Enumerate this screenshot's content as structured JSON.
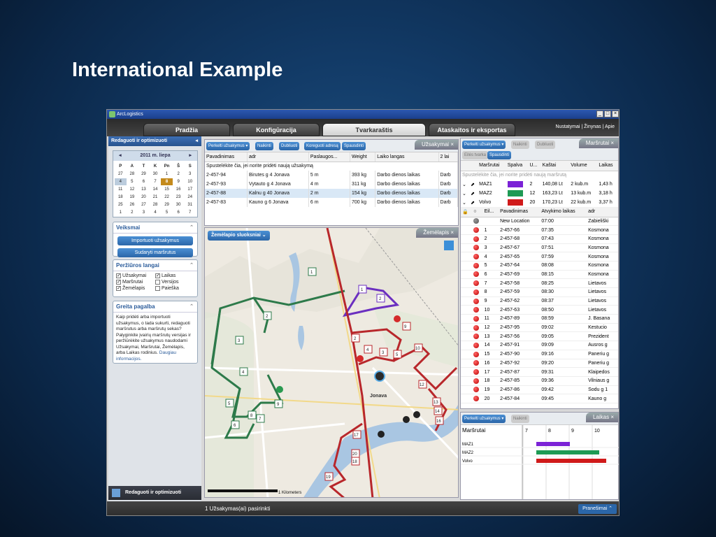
{
  "slide": {
    "title": "International Example"
  },
  "window": {
    "title": "ArcLogistics"
  },
  "ribbon": {
    "tabs": [
      "Pradžia",
      "Konfigūracija",
      "Tvarkaraštis",
      "Ataskaitos ir eksportas"
    ],
    "active_tab": "Tvarkaraštis",
    "links": "Nustatymai | Žinynas | Apie"
  },
  "left_panel": {
    "header": "Redaguoti ir optimizuoti",
    "calendar": {
      "month": "2011 m. liepa",
      "day_names": [
        "P",
        "A",
        "T",
        "K",
        "Pn",
        "Š",
        "S"
      ],
      "weeks": [
        [
          "27",
          "28",
          "29",
          "30",
          "1",
          "2",
          "3"
        ],
        [
          "4",
          "5",
          "6",
          "7",
          "8",
          "9",
          "10"
        ],
        [
          "11",
          "12",
          "13",
          "14",
          "15",
          "16",
          "17"
        ],
        [
          "18",
          "19",
          "20",
          "21",
          "22",
          "23",
          "24"
        ],
        [
          "25",
          "26",
          "27",
          "28",
          "29",
          "30",
          "31"
        ],
        [
          "1",
          "2",
          "3",
          "4",
          "5",
          "6",
          "7"
        ]
      ],
      "selected": "8"
    },
    "actions": {
      "title": "Veiksmai",
      "buttons": [
        "Importuoti užsakymus",
        "Sudaryti maršrutus"
      ]
    },
    "views": {
      "title": "Peržiūros langai",
      "items": [
        {
          "label": "Užsakymai",
          "checked": true
        },
        {
          "label": "Laikas",
          "checked": true
        },
        {
          "label": "Maršrutai",
          "checked": true
        },
        {
          "label": "Versijos",
          "checked": false
        },
        {
          "label": "Žemėlapis",
          "checked": true
        },
        {
          "label": "Paieška",
          "checked": false
        }
      ]
    },
    "help": {
      "title": "Greita pagalba",
      "text": "Kaip pridėti arba importuoti užsakymus, o tada sukurti, redaguoti maršrutus arba maršrutų sekas? Palyginkite įvairių maršrutų versijas ir peržiūrėkite užsakymus naudodami Užsakymai, Maršrutai, Žemėlapis, arba Laikas rodinius.",
      "link": "Daugiau informacijos."
    },
    "footer": "Redaguoti ir optimizuoti"
  },
  "orders": {
    "title": "Užsakymai",
    "toolbar": [
      "Perkelti užsakymus ▾",
      "Naikinti",
      "Dubliuoti",
      "Koreguoti adresą",
      "Spausdinti"
    ],
    "columns": [
      "Pavadinimas",
      "adr",
      "Paslaugos...",
      "Weight",
      "Laiko langas",
      "2 lai"
    ],
    "hint": "Spustelėkite čia, jei norite pridėti naują užsakymą",
    "rows": [
      [
        "2-457-94",
        "Birutes g 4 Jonava",
        "5 m",
        "393 kg",
        "Darbo dienos laikas",
        "Darb"
      ],
      [
        "2-457-93",
        "Vytauto g 4 Jonava",
        "4 m",
        "311 kg",
        "Darbo dienos laikas",
        "Darb"
      ],
      [
        "2-457-88",
        "Kalnu g 40 Jonava",
        "2 m",
        "154 kg",
        "Darbo dienos laikas",
        "Darb"
      ],
      [
        "2-457-83",
        "Kauno g 6 Jonava",
        "6 m",
        "700 kg",
        "Darbo dienos laikas",
        "Darb"
      ]
    ]
  },
  "map": {
    "title": "Žemėlapis",
    "layers_button": "Žemėlapio sluoksniai",
    "town": "Jonava",
    "scale": "1 Kilometers",
    "route_stops": {
      "green": [
        "1",
        "2",
        "3",
        "4",
        "5",
        "6",
        "7",
        "8",
        "9"
      ],
      "purple": [
        "1",
        "2"
      ],
      "red": [
        "2",
        "3",
        "4",
        "5",
        "9",
        "10",
        "11",
        "12",
        "13",
        "14",
        "15",
        "16",
        "17",
        "18",
        "19",
        "20"
      ]
    }
  },
  "routes": {
    "title": "Maršrutai",
    "toolbar": [
      "Perkelti užsakymus ▾",
      "Naikinti",
      "Dubliuoti",
      "Eilės tvarka",
      "Spausdinti"
    ],
    "columns": [
      "Maršrutai",
      "Spalva",
      "U...",
      "Kaštai",
      "Volume",
      "Laikas"
    ],
    "hint": "Spustelėkite čia, jei norite pridėti naują maršrutą",
    "rows": [
      {
        "name": "MAZ1",
        "color": "#7b22d6",
        "u": "2",
        "cost": "140,08 Lt",
        "volume": "2 kub.m",
        "time": "1,43 h"
      },
      {
        "name": "MAZ2",
        "color": "#1e9a54",
        "u": "12",
        "cost": "163,23 Lt",
        "volume": "13 kub.m",
        "time": "3,18 h"
      },
      {
        "name": "Volvo",
        "color": "#d01a1a",
        "u": "20",
        "cost": "170,23 Lt",
        "volume": "22 kub.m",
        "time": "3,37 h"
      }
    ],
    "stop_columns": [
      "Eil...",
      "Pavadinimas",
      "Atvykimo laikas",
      "adr"
    ],
    "stops": [
      [
        "",
        "New Location",
        "07:00",
        "Zabieliški"
      ],
      [
        "1",
        "2-457-66",
        "07:35",
        "Kosmona"
      ],
      [
        "2",
        "2-457-68",
        "07:43",
        "Kosmona"
      ],
      [
        "3",
        "2-457-67",
        "07:51",
        "Kosmona"
      ],
      [
        "4",
        "2-457-65",
        "07:59",
        "Kosmona"
      ],
      [
        "5",
        "2-457-64",
        "08:08",
        "Kosmona"
      ],
      [
        "6",
        "2-457-69",
        "08:15",
        "Kosmona"
      ],
      [
        "7",
        "2-457-58",
        "08:25",
        "Lietavos"
      ],
      [
        "8",
        "2-457-59",
        "08:30",
        "Lietavos"
      ],
      [
        "9",
        "2-457-62",
        "08:37",
        "Lietavos"
      ],
      [
        "10",
        "2-457-63",
        "08:50",
        "Lietavos"
      ],
      [
        "11",
        "2-457-89",
        "08:59",
        "J. Basana"
      ],
      [
        "12",
        "2-457-95",
        "09:02",
        "Kestucio"
      ],
      [
        "13",
        "2-457-56",
        "09:05",
        "Prezident"
      ],
      [
        "14",
        "2-457-91",
        "09:09",
        "Ausros g"
      ],
      [
        "15",
        "2-457-90",
        "09:16",
        "Paneriu g"
      ],
      [
        "16",
        "2-457-92",
        "09:20",
        "Paneriu g"
      ],
      [
        "17",
        "2-457-87",
        "09:31",
        "Klaipedos"
      ],
      [
        "18",
        "2-457-85",
        "09:36",
        "Vilniaus g"
      ],
      [
        "19",
        "2-457-86",
        "09:42",
        "Sodu g 1"
      ],
      [
        "20",
        "2-457-84",
        "09:45",
        "Kauno g"
      ]
    ]
  },
  "timeline": {
    "title": "Laikas",
    "toolbar": [
      "Perkelti užsakymus ▾",
      "Naikinti"
    ],
    "column": "Maršrutai",
    "hours": [
      "7",
      "8",
      "9",
      "10"
    ],
    "rows": [
      "MAZ1",
      "MAZ2",
      "Volvo"
    ]
  },
  "status": {
    "text": "1 Užsakymas(ai) pasirinkti",
    "messages": "Pranešimai"
  }
}
